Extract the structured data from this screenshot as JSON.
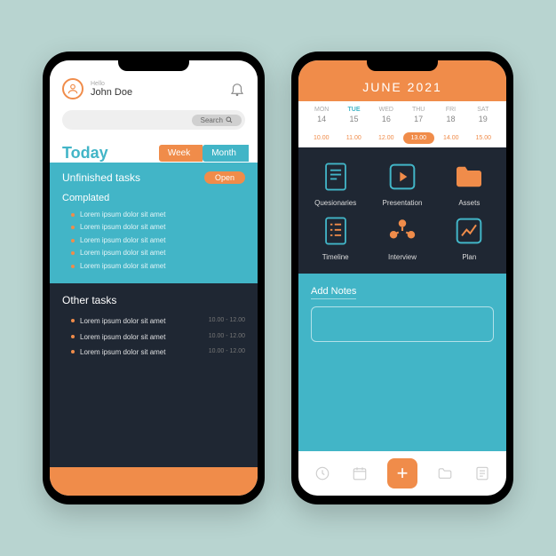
{
  "colors": {
    "teal": "#42b5c7",
    "orange": "#f08c4a",
    "dark": "#1f2733"
  },
  "phone1": {
    "hello": "Hello",
    "username": "John Doe",
    "search_label": "Search",
    "tabs": {
      "today": "Today",
      "week": "Week",
      "month": "Month"
    },
    "unfinished_label": "Unfinished tasks",
    "open_label": "Open",
    "completed_label": "Complated",
    "completed_tasks": [
      "Lorem ipsum dolor sit amet",
      "Lorem ipsum dolor sit amet",
      "Lorem ipsum dolor sit amet",
      "Lorem ipsum dolor sit amet",
      "Lorem ipsum dolor sit amet"
    ],
    "other_label": "Other tasks",
    "other_tasks": [
      {
        "text": "Lorem ipsum dolor sit amet",
        "time": "10.00 - 12.00"
      },
      {
        "text": "Lorem ipsum dolor sit amet",
        "time": "10.00 - 12.00"
      },
      {
        "text": "Lorem ipsum dolor sit amet",
        "time": "10.00 - 12.00"
      }
    ]
  },
  "phone2": {
    "month_title": "JUNE 2021",
    "weekdays": [
      "MON",
      "TUE",
      "WED",
      "THU",
      "FRI",
      "SAT"
    ],
    "active_weekday_index": 1,
    "daynums": [
      "14",
      "15",
      "16",
      "17",
      "18",
      "19"
    ],
    "times": [
      "10.00",
      "11.00",
      "12.00",
      "13.00",
      "14.00",
      "15.00"
    ],
    "active_time_index": 3,
    "categories": [
      {
        "label": "Quesionaries",
        "icon": "document-icon"
      },
      {
        "label": "Presentation",
        "icon": "play-icon"
      },
      {
        "label": "Assets",
        "icon": "folder-icon"
      },
      {
        "label": "Timeline",
        "icon": "list-icon"
      },
      {
        "label": "Interview",
        "icon": "people-icon"
      },
      {
        "label": "Plan",
        "icon": "chart-icon"
      }
    ],
    "notes_label": "Add Notes",
    "nav_plus": "+"
  }
}
